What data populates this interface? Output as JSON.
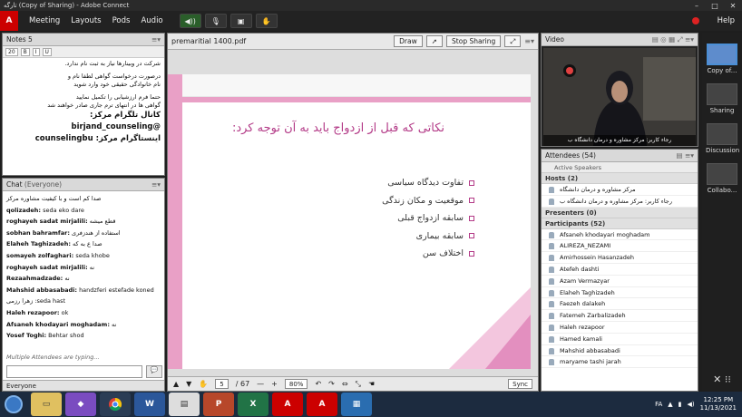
{
  "window": {
    "title": "تارگه (Copy of Sharing) - Adobe Connect"
  },
  "menu": {
    "logo": "Adobe",
    "items": [
      "Meeting",
      "Layouts",
      "Pods",
      "Audio"
    ],
    "help": "Help"
  },
  "notes": {
    "title": "Notes 5",
    "font_size": "20",
    "lines": [
      "شرکت در وبینارها نیاز به ثبت نام ندارد.",
      "درصورت درخواست گواهی لطفا نام و",
      "نام خانوادگی حقیقی خود وارد شوید",
      "حتما فرم ارزشیابی را تکمیل نمایید",
      "گواهی ها در انتهای ترم جاری صادر خواهند شد"
    ],
    "telegram_label": "کانال تلگرام مرکز:",
    "telegram_handle": "@birjand_counseling",
    "instagram_label": "اینستاگرام مرکز:",
    "instagram_handle": "counselingbu"
  },
  "chat": {
    "title": "Chat",
    "scope": "(Everyone)",
    "messages": [
      {
        "from": "",
        "text": "صدا کم است و با کیفیت مشاوره مرکز"
      },
      {
        "from": "qolizadeh:",
        "text": "seda eko dare"
      },
      {
        "from": "roghayeh sadat mirjalili:",
        "text": "قطع میشه"
      },
      {
        "from": "sobhan bahramfar:",
        "text": "استفاده از هندزفری"
      },
      {
        "from": "Elaheh Taghizadeh:",
        "text": "صدا ع به که"
      },
      {
        "from": "somayeh zolfaghari:",
        "text": "seda khobe"
      },
      {
        "from": "roghayeh sadat mirjalili:",
        "text": "نه"
      },
      {
        "from": "Rezaahmadzade:",
        "text": "نه"
      },
      {
        "from": "Mahshid abbasabadi:",
        "text": "handzferi estefade koned"
      },
      {
        "from": "",
        "text": "زهرا رزمی :seda hast"
      },
      {
        "from": "Haleh rezapoor:",
        "text": "ok"
      },
      {
        "from": "Afsaneh khodayari moghadam:",
        "text": "نه"
      },
      {
        "from": "Yosef Toghi:",
        "text": "Behtar shod"
      }
    ],
    "typing": "Multiple Attendees are typing...",
    "footer": "Everyone"
  },
  "share": {
    "file": "premaritial 1400.pdf",
    "draw": "Draw",
    "stop": "Stop Sharing",
    "slide_heading": "نکاتی که قبل از ازدواج باید به آن توجه کرد:",
    "bullets": [
      "تفاوت دیدگاه سیاسی",
      "موقعیت و مکان زندگی",
      "سابقه ازدواج قبلی",
      "سابقه بیماری",
      "اختلاف سن"
    ],
    "page": "5",
    "total": "/ 67",
    "zoom": "80%",
    "sync": "Sync"
  },
  "video": {
    "title": "Video",
    "caption": "رجاء کاربر: مرکز مشاوره و درمان دانشگاه ب"
  },
  "attendees": {
    "title": "Attendees",
    "count": "(54)",
    "active": "Active Speakers",
    "hosts_label": "Hosts (2)",
    "hosts": [
      "مرکز مشاوره و درمان دانشگاه",
      "رجاء کاربر: مرکز مشاوره و درمان دانشگاه ب"
    ],
    "presenters_label": "Presenters (0)",
    "participants_label": "Participants (52)",
    "participants": [
      "Afsaneh khodayari moghadam",
      "ALIREZA_NEZAMI",
      "Amirhossein Hasanzadeh",
      "Atefeh dashti",
      "Azam Vermazyar",
      "Elaheh Taghizadeh",
      "Faezeh dalakeh",
      "Fatemeh Zarbalizadeh",
      "Haleh rezapoor",
      "Hamed kamali",
      "Mahshid abbasabadi",
      "maryame tashi jarah"
    ]
  },
  "rail": {
    "items": [
      "Copy of...",
      "Sharing",
      "Discussion",
      "Collabo..."
    ]
  },
  "taskbar": {
    "lang": "FA",
    "time": "12:25 PM",
    "date": "11/13/2021"
  }
}
